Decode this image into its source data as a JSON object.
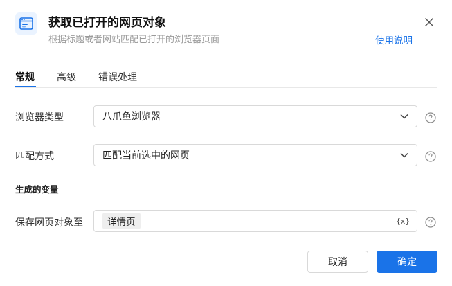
{
  "header": {
    "title": "获取已打开的网页对象",
    "subtitle": "根据标题或者网站匹配已打开的浏览器页面",
    "help_link": "使用说明",
    "icon": "browser-window-icon"
  },
  "tabs": [
    {
      "label": "常规",
      "active": true
    },
    {
      "label": "高级",
      "active": false
    },
    {
      "label": "错误处理",
      "active": false
    }
  ],
  "form": {
    "browser_type": {
      "label": "浏览器类型",
      "value": "八爪鱼浏览器"
    },
    "match_mode": {
      "label": "匹配方式",
      "value": "匹配当前选中的网页"
    },
    "output_section": "生成的变量",
    "save_to": {
      "label": "保存网页对象至",
      "tag": "详情页",
      "var_button": "{x}"
    }
  },
  "buttons": {
    "cancel": "取消",
    "confirm": "确定"
  },
  "colors": {
    "accent": "#1a73e8"
  }
}
